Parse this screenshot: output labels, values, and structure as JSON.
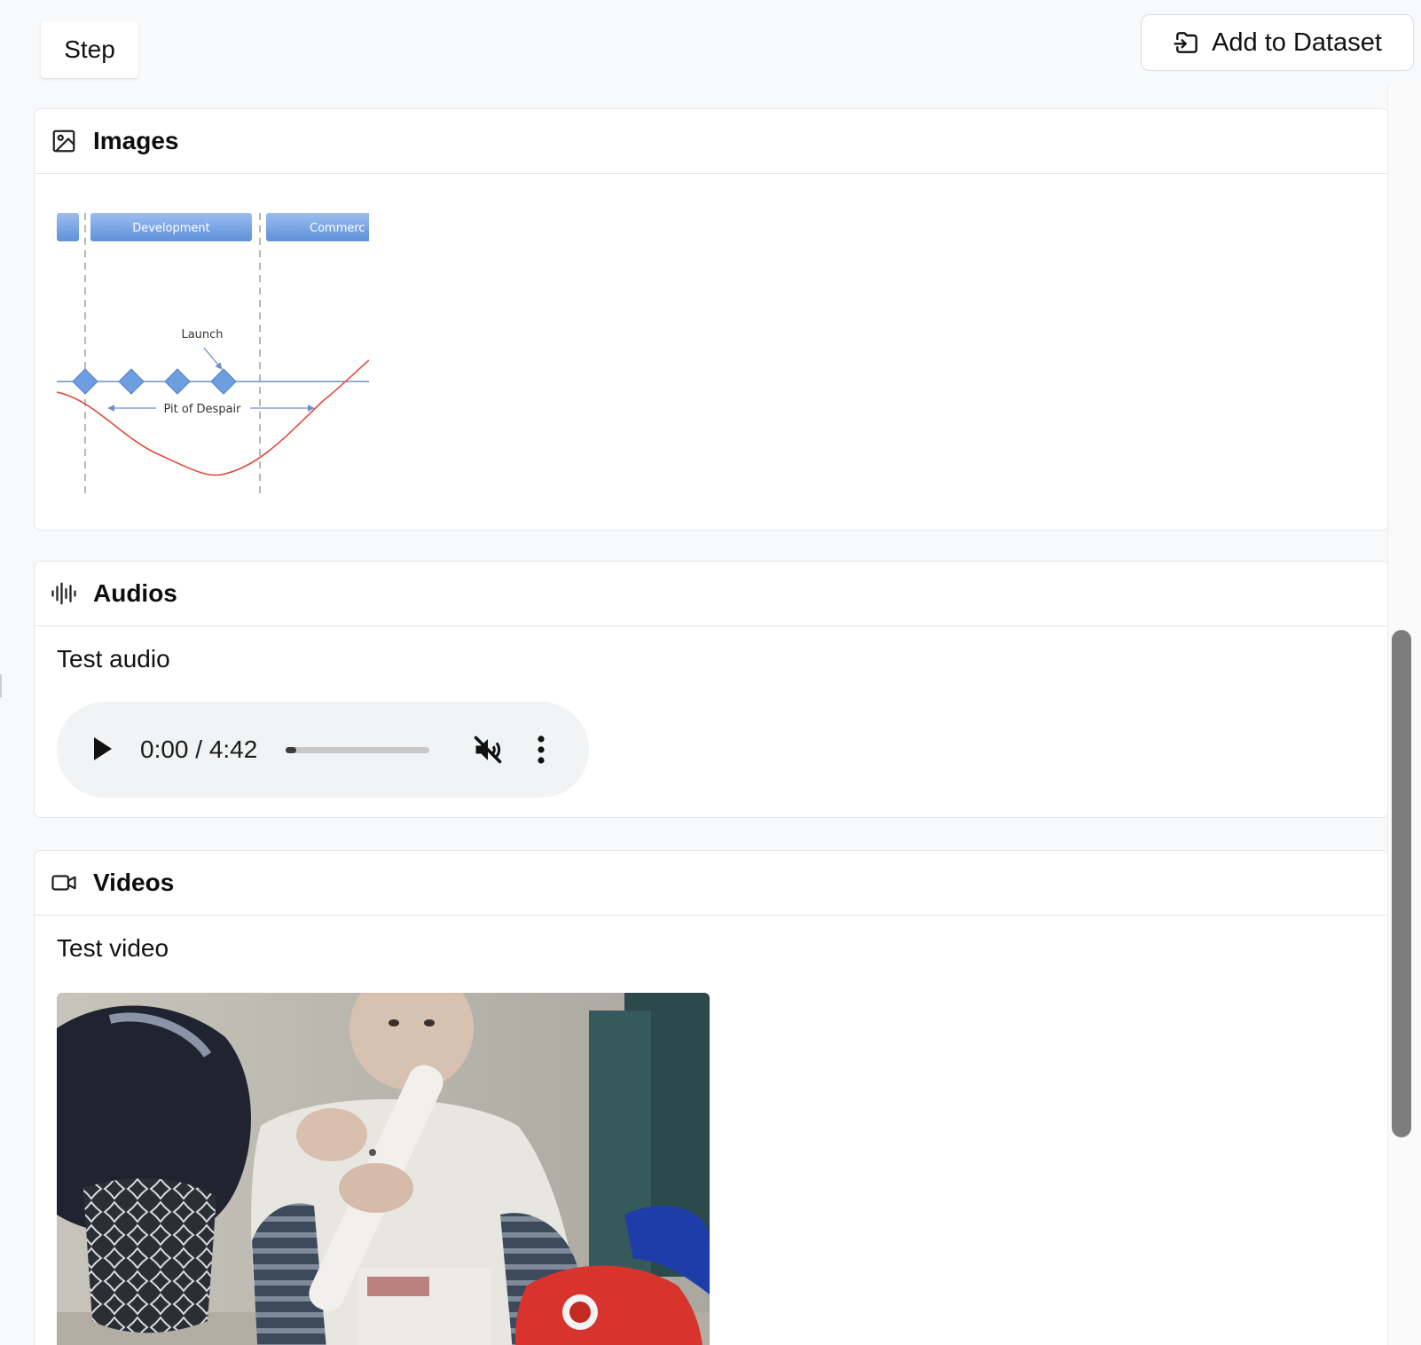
{
  "toolbar": {
    "step_tab": "Step",
    "add_dataset_label": "Add to Dataset"
  },
  "sections": {
    "images": {
      "title": "Images",
      "icon": "image-icon",
      "diagram": {
        "phase_labels": [
          "Development",
          "Commerc"
        ],
        "launch_label": "Launch",
        "pit_label": "Pit of Despair"
      }
    },
    "audios": {
      "title": "Audios",
      "icon": "audio-waveform-icon",
      "item_label": "Test audio",
      "player": {
        "time": "0:00 / 4:42",
        "progress_fraction": 0.0,
        "muted": true
      }
    },
    "videos": {
      "title": "Videos",
      "icon": "video-camera-icon",
      "item_label": "Test video"
    }
  },
  "colors": {
    "accent_blue": "#6d9ee0",
    "curve_red": "#e24a3b",
    "scrollbar_thumb": "#7d7d7d"
  }
}
